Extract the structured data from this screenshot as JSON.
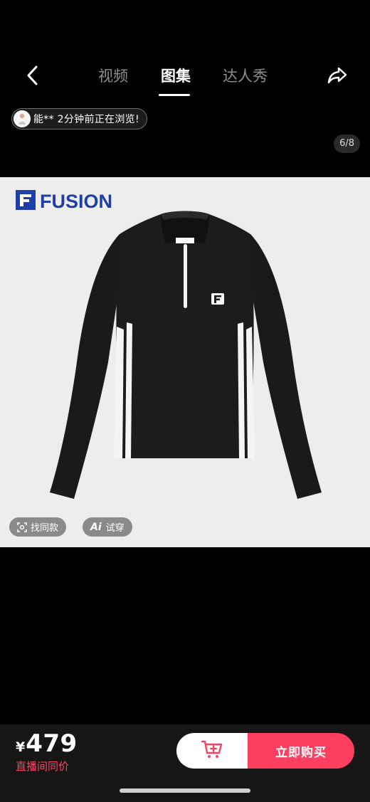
{
  "tabs": [
    {
      "label": "视频",
      "active": false
    },
    {
      "label": "图集",
      "active": true
    },
    {
      "label": "达人秀",
      "active": false
    }
  ],
  "browse_notice": "能** 2分钟前正在浏览!",
  "image_counter": "6/8",
  "brand": {
    "name": "FUSION",
    "color": "#1e3fa8"
  },
  "chips": {
    "find_similar": "找同款",
    "ai_tryon_label": "试穿",
    "ai_glyph": "Ai"
  },
  "price": {
    "currency": "¥",
    "amount": "479",
    "subtitle": "直播间同价"
  },
  "buttons": {
    "buy_now": "立即购买"
  },
  "colors": {
    "accent": "#ff3f5f",
    "price_sub": "#ff4466",
    "background": "#000000"
  },
  "icons": {
    "back": "chevron-left-icon",
    "share": "share-icon",
    "cart": "add-to-cart-icon",
    "find": "scan-icon"
  }
}
